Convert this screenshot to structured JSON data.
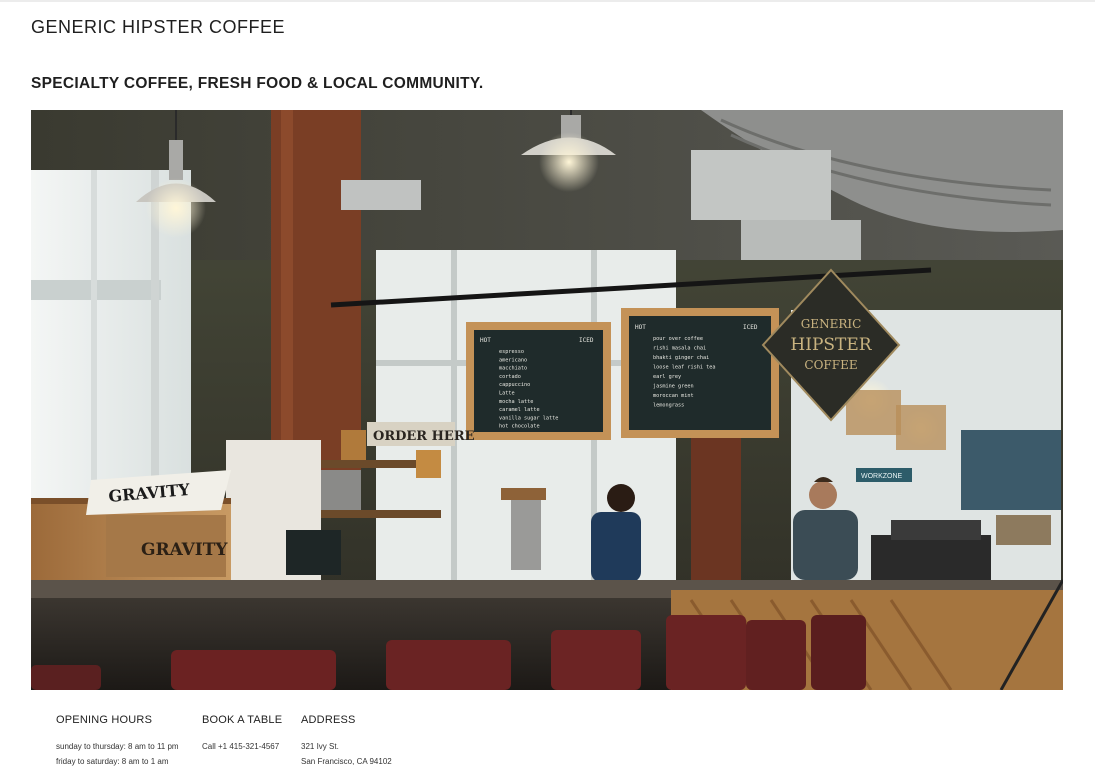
{
  "header": {
    "site_title": "GENERIC HIPSTER COFFEE",
    "tagline": "SPECIALTY COFFEE, FRESH FOOD & LOCAL COMMUNITY."
  },
  "hero": {
    "description_icon": "coffee-shop-photo",
    "chalkboard_left": {
      "header_left": "HOT",
      "header_right": "ICED",
      "items": [
        "espresso",
        "americano",
        "macchiato",
        "cortado",
        "cappuccino",
        "Latte",
        "mocha latte",
        "caramel latte",
        "vanilla sugar latte",
        "hot chocolate"
      ]
    },
    "chalkboard_right": {
      "header_left": "HOT",
      "header_right": "ICED",
      "items": [
        "pour over coffee",
        "rishi masala chai",
        "bhakti ginger chai",
        "loose leaf rishi tea",
        "earl grey",
        "jasmine green",
        "moroccan mint",
        "lemongrass"
      ]
    },
    "order_sign": "ORDER HERE",
    "diamond_sign": [
      "GENERIC",
      "HIPSTER",
      "COFFEE"
    ],
    "crate_text": "GRAVITY",
    "magazine_text": "GRAVITY",
    "workzone_sign": "WORKZONE"
  },
  "footer": {
    "hours": {
      "heading": "OPENING HOURS",
      "lines": [
        "sunday to thursday: 8 am to 11 pm",
        "friday to saturday: 8 am to 1 am"
      ]
    },
    "booking": {
      "heading": "BOOK A TABLE",
      "lines": [
        "Call +1 415-321-4567"
      ]
    },
    "address": {
      "heading": "ADDRESS",
      "lines": [
        "321 Ivy St.",
        "San Francisco, CA 94102"
      ]
    }
  },
  "colors": {
    "background": "#ffffff",
    "text": "#1f1f1f",
    "chalkboard": "#1e2a2a",
    "wood": "#b07a45"
  }
}
